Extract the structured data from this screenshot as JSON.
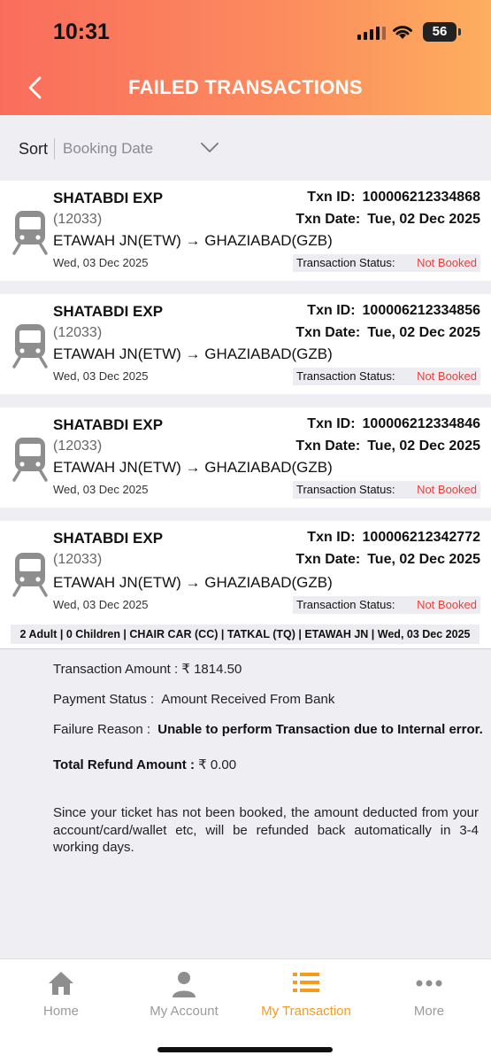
{
  "status_bar": {
    "time": "10:31",
    "battery": "56"
  },
  "header": {
    "title": "FAILED TRANSACTIONS"
  },
  "sort": {
    "label": "Sort",
    "value": "Booking Date"
  },
  "labels": {
    "txn_id": "Txn ID:",
    "txn_date": "Txn Date:",
    "status": "Transaction Status:"
  },
  "transactions": [
    {
      "train_name": "SHATABDI EXP",
      "train_no": "(12033)",
      "route": "ETAWAH JN(ETW) → GHAZIABAD(GZB)",
      "journey_date": "Wed, 03 Dec 2025",
      "txn_id": "100006212334868",
      "txn_date": "Tue, 02 Dec 2025",
      "status": "Not Booked"
    },
    {
      "train_name": "SHATABDI EXP",
      "train_no": "(12033)",
      "route": "ETAWAH JN(ETW) → GHAZIABAD(GZB)",
      "journey_date": "Wed, 03 Dec 2025",
      "txn_id": "100006212334856",
      "txn_date": "Tue, 02 Dec 2025",
      "status": "Not Booked"
    },
    {
      "train_name": "SHATABDI EXP",
      "train_no": "(12033)",
      "route": "ETAWAH JN(ETW) → GHAZIABAD(GZB)",
      "journey_date": "Wed, 03 Dec 2025",
      "txn_id": "100006212334846",
      "txn_date": "Tue, 02 Dec 2025",
      "status": "Not Booked"
    },
    {
      "train_name": "SHATABDI EXP",
      "train_no": "(12033)",
      "route": "ETAWAH JN(ETW) → GHAZIABAD(GZB)",
      "journey_date": "Wed, 03 Dec 2025",
      "txn_id": "100006212342772",
      "txn_date": "Tue, 02 Dec 2025",
      "status": "Not Booked"
    }
  ],
  "expanded": {
    "summary": "2 Adult | 0 Children | CHAIR CAR (CC) | TATKAL (TQ) | ETAWAH JN | Wed, 03 Dec 2025",
    "amount_label": "Transaction Amount :",
    "amount_value": "₹ 1814.50",
    "payment_label": "Payment Status :",
    "payment_value": "Amount Received From Bank",
    "failure_label": "Failure Reason :",
    "failure_value": "Unable to perform Transaction due to Internal error.",
    "refund_label": "Total Refund Amount :",
    "refund_value": "₹ 0.00",
    "note": "Since your ticket has not been booked, the amount deducted from your account/card/wallet etc, will be refunded back automatically in 3-4 working days."
  },
  "tabs": [
    {
      "label": "Home",
      "icon": "home-icon"
    },
    {
      "label": "My Account",
      "icon": "person-icon"
    },
    {
      "label": "My Transaction",
      "icon": "list-icon",
      "active": true
    },
    {
      "label": "More",
      "icon": "more-icon"
    }
  ],
  "colors": {
    "accent": "#f89a1c",
    "status_failed": "#e8413c",
    "header_start": "#f96d5c",
    "header_end": "#fdae5f"
  }
}
